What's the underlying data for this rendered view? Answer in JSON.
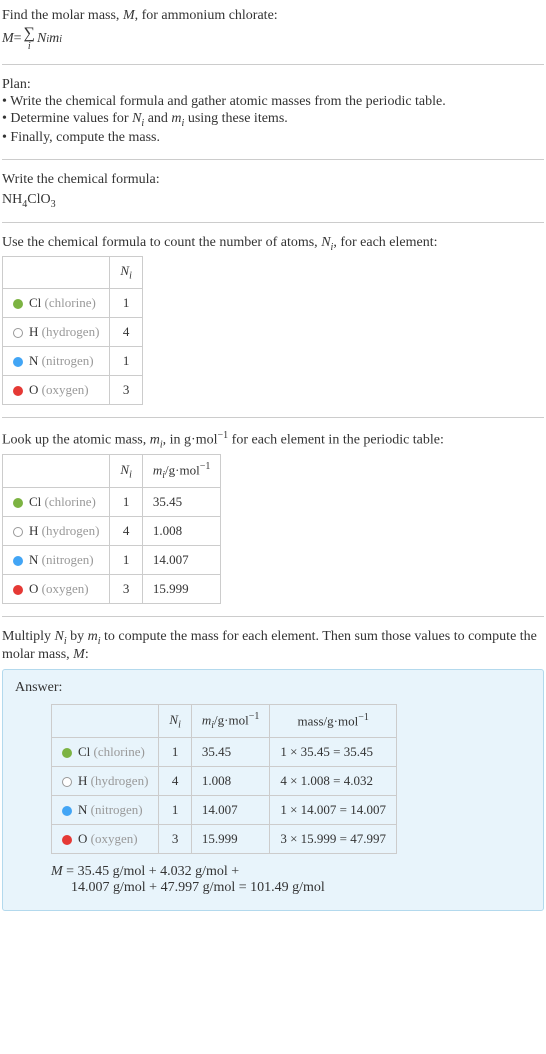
{
  "intro": {
    "line1_prefix": "Find the molar mass, ",
    "line1_M": "M",
    "line1_suffix": ", for ammonium chlorate:",
    "eq_lhs": "M",
    "eq_eq": " = ",
    "eq_sigma": "∑",
    "eq_sigma_sub": "i",
    "eq_N": "N",
    "eq_N_sub": "i",
    "eq_m": "m",
    "eq_m_sub": "i"
  },
  "plan": {
    "title": "Plan:",
    "b1_pre": "• Write the chemical formula and gather atomic masses from the periodic table.",
    "b2_pre": "• Determine values for ",
    "b2_N": "N",
    "b2_Ni": "i",
    "b2_and": " and ",
    "b2_m": "m",
    "b2_mi": "i",
    "b2_post": " using these items.",
    "b3": "• Finally, compute the mass."
  },
  "formula": {
    "title": "Write the chemical formula:",
    "nh": "NH",
    "s4": "4",
    "cl": "ClO",
    "s3": "3"
  },
  "count": {
    "title_pre": "Use the chemical formula to count the number of atoms, ",
    "title_N": "N",
    "title_Ni": "i",
    "title_post": ", for each element:",
    "hdr_N": "N",
    "hdr_Ni": "i",
    "rows": [
      {
        "dot": "dot-green",
        "sym": "Cl",
        "name": "(chlorine)",
        "n": "1"
      },
      {
        "dot": "dot-white",
        "sym": "H",
        "name": "(hydrogen)",
        "n": "4"
      },
      {
        "dot": "dot-blue",
        "sym": "N",
        "name": "(nitrogen)",
        "n": "1"
      },
      {
        "dot": "dot-red",
        "sym": "O",
        "name": "(oxygen)",
        "n": "3"
      }
    ]
  },
  "lookup": {
    "title_pre": "Look up the atomic mass, ",
    "title_m": "m",
    "title_mi": "i",
    "title_mid": ", in g·mol",
    "title_exp": "−1",
    "title_post": " for each element in the periodic table:",
    "hdr_N": "N",
    "hdr_Ni": "i",
    "hdr_m": "m",
    "hdr_mi": "i",
    "hdr_unit": "/g·mol",
    "hdr_unit_exp": "−1",
    "rows": [
      {
        "dot": "dot-green",
        "sym": "Cl",
        "name": "(chlorine)",
        "n": "1",
        "m": "35.45"
      },
      {
        "dot": "dot-white",
        "sym": "H",
        "name": "(hydrogen)",
        "n": "4",
        "m": "1.008"
      },
      {
        "dot": "dot-blue",
        "sym": "N",
        "name": "(nitrogen)",
        "n": "1",
        "m": "14.007"
      },
      {
        "dot": "dot-red",
        "sym": "O",
        "name": "(oxygen)",
        "n": "3",
        "m": "15.999"
      }
    ]
  },
  "multiply": {
    "pre": "Multiply ",
    "N": "N",
    "Ni": "i",
    "by": " by ",
    "m": "m",
    "mi": "i",
    "mid": " to compute the mass for each element. Then sum those values to compute the molar mass, ",
    "M": "M",
    "post": ":"
  },
  "answer": {
    "title": "Answer:",
    "hdr_N": "N",
    "hdr_Ni": "i",
    "hdr_m": "m",
    "hdr_mi": "i",
    "hdr_mu": "/g·mol",
    "hdr_mu_exp": "−1",
    "hdr_mass": "mass/g·mol",
    "hdr_mass_exp": "−1",
    "rows": [
      {
        "dot": "dot-green",
        "sym": "Cl",
        "name": "(chlorine)",
        "n": "1",
        "m": "35.45",
        "calc": "1 × 35.45 = 35.45"
      },
      {
        "dot": "dot-white",
        "sym": "H",
        "name": "(hydrogen)",
        "n": "4",
        "m": "1.008",
        "calc": "4 × 1.008 = 4.032"
      },
      {
        "dot": "dot-blue",
        "sym": "N",
        "name": "(nitrogen)",
        "n": "1",
        "m": "14.007",
        "calc": "1 × 14.007 = 14.007"
      },
      {
        "dot": "dot-red",
        "sym": "O",
        "name": "(oxygen)",
        "n": "3",
        "m": "15.999",
        "calc": "3 × 15.999 = 47.997"
      }
    ],
    "eq_M": "M",
    "eq_line1": " = 35.45 g/mol + 4.032 g/mol + ",
    "eq_line2": "14.007 g/mol + 47.997 g/mol = 101.49 g/mol"
  },
  "chart_data": {
    "type": "table",
    "title": "Molar mass of ammonium chlorate NH4ClO3",
    "columns": [
      "element",
      "N_i",
      "m_i (g/mol)",
      "mass (g/mol)"
    ],
    "rows": [
      [
        "Cl",
        1,
        35.45,
        35.45
      ],
      [
        "H",
        4,
        1.008,
        4.032
      ],
      [
        "N",
        1,
        14.007,
        14.007
      ],
      [
        "O",
        3,
        15.999,
        47.997
      ]
    ],
    "total_molar_mass_g_per_mol": 101.49
  }
}
